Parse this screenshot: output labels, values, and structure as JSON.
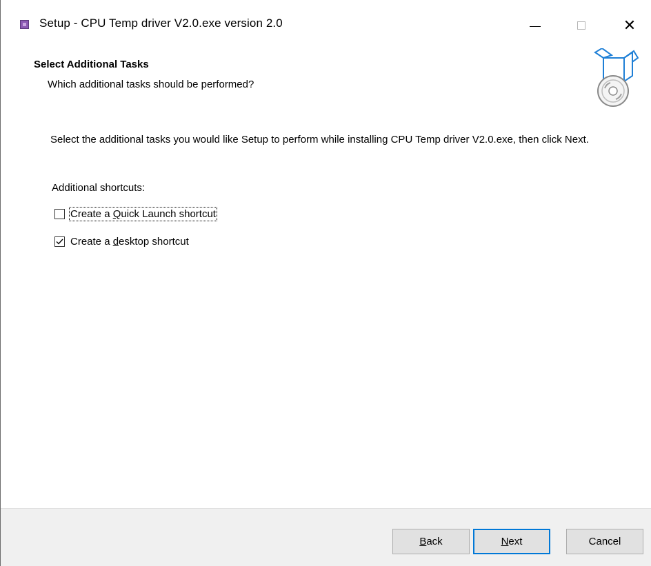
{
  "window": {
    "title": "Setup - CPU Temp driver V2.0.exe version 2.0"
  },
  "header": {
    "title": "Select Additional Tasks",
    "subtitle": "Which additional tasks should be performed?"
  },
  "body": {
    "description": "Select the additional tasks you would like Setup to perform while installing CPU Temp driver V2.0.exe, then click Next.",
    "group_label": "Additional shortcuts:",
    "tasks": [
      {
        "label_pre": "Create a ",
        "label_access": "Q",
        "label_post": "uick Launch shortcut",
        "checked": false,
        "focused": true
      },
      {
        "label_pre": "Create a ",
        "label_access": "d",
        "label_post": "esktop shortcut",
        "checked": true,
        "focused": false
      }
    ]
  },
  "buttons": {
    "back_access": "B",
    "back_rest": "ack",
    "next_access": "N",
    "next_rest": "ext",
    "cancel": "Cancel"
  },
  "colors": {
    "accent": "#0078d7",
    "footer_bg": "#f0f0f0",
    "button_bg": "#e1e1e1"
  }
}
